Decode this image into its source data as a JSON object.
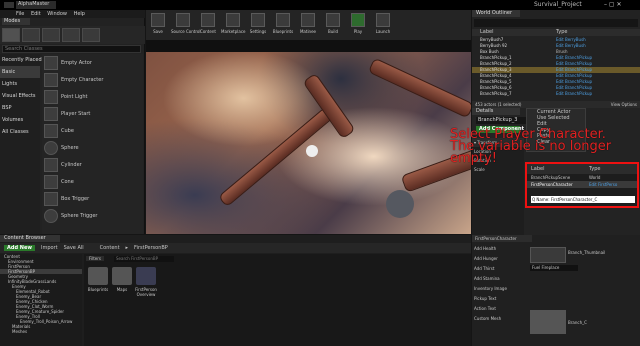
{
  "titlebar": {
    "app_title": "Survival_Project",
    "tab_label": "AlphaMaster"
  },
  "menu": [
    "File",
    "Edit",
    "Window",
    "Help"
  ],
  "modes": {
    "tab": "Modes",
    "search_placeholder": "Search Classes",
    "categories": [
      "Recently Placed",
      "Basic",
      "Lights",
      "Visual Effects",
      "BSP",
      "Volumes",
      "All Classes"
    ],
    "actors": [
      "Empty Actor",
      "Empty Character",
      "Point Light",
      "Player Start",
      "Cube",
      "Sphere",
      "Cylinder",
      "Cone",
      "Box Trigger",
      "Sphere Trigger"
    ]
  },
  "toolbar": [
    "Save",
    "Source Control",
    "Content",
    "Marketplace",
    "Settings",
    "Blueprints",
    "Matinee",
    "Build",
    "Play",
    "Launch"
  ],
  "outliner": {
    "tab": "World Outliner",
    "col_label": "Label",
    "col_type": "Type",
    "rows": [
      {
        "n": "BerryBush7",
        "t": "Edit BerryBush"
      },
      {
        "n": "BerryBush 92",
        "t": "Edit BerryBush"
      },
      {
        "n": "Box Bush",
        "t": "Brush"
      },
      {
        "n": "BranchPickup_1",
        "t": "Edit BranchPickup"
      },
      {
        "n": "BranchPickup_2",
        "t": "Edit BranchPickup"
      },
      {
        "n": "BranchPickup_3",
        "t": "Edit BranchPickup"
      },
      {
        "n": "BranchPickup_4",
        "t": "Edit BranchPickup"
      },
      {
        "n": "BranchPickup_5",
        "t": "Edit BranchPickup"
      },
      {
        "n": "BranchPickup_6",
        "t": "Edit BranchPickup"
      },
      {
        "n": "BranchPickup_7",
        "t": "Edit BranchPickup"
      }
    ],
    "selected_index": 5,
    "footer": "453 actors (1 selected)",
    "view_options": "View Options"
  },
  "details": {
    "tab": "Details",
    "context_menu": [
      "Current Actor",
      "Use Selected",
      "Edit",
      "Copy",
      "Paste",
      "Clear"
    ],
    "name_field": "BranchPickup_3",
    "add_component": "Add Component",
    "picker_col_label": "Label",
    "picker_col_type": "Type",
    "picker_row_name": "FirstPersonCharacter",
    "picker_row_type": "Edit FirstPerso",
    "picker_group": "BranchPickupScene",
    "picker_world": "World",
    "picker_footer": "Q Name: FirstPersonCharacter_C"
  },
  "annotation": "Select Player Character. The variable is no longer empty!",
  "content_browser": {
    "tab": "Content Browser",
    "add_new": "Add New",
    "import": "Import",
    "save_all": "Save All",
    "path": [
      "Content",
      "FirstPersonBP"
    ],
    "filters": "Filters",
    "search_placeholder": "Search FirstPersonBP",
    "tree": [
      "Content",
      "Environment",
      "FirstPerson",
      "FirstPersonBP",
      "Geometry",
      "InfinityBladeGrassLands",
      "Enemy",
      "Elemental_Robot",
      "Enemy_Bear",
      "Enemy_Chicken",
      "Enemy_Clot_Worm",
      "Enemy_Creature_Spider",
      "Enemy_Troll",
      "Enemy_Troll_Poison_Arrow",
      "Materials",
      "Meshes"
    ],
    "tree_selected": 3,
    "assets": [
      "Blueprints",
      "Maps",
      "FirstPerson Overview"
    ]
  },
  "blueprint": {
    "header": "FirstPersonCharacter",
    "rows": [
      "Add Health",
      "Add Hunger",
      "Add Thirst",
      "Add Stamina",
      "Inventory Image",
      "Pickup Text",
      "Action Text",
      "Custom Mesh"
    ],
    "values": [
      "Branch_Thumbnail",
      "Fuel Fireplace",
      "Branch_C"
    ]
  }
}
